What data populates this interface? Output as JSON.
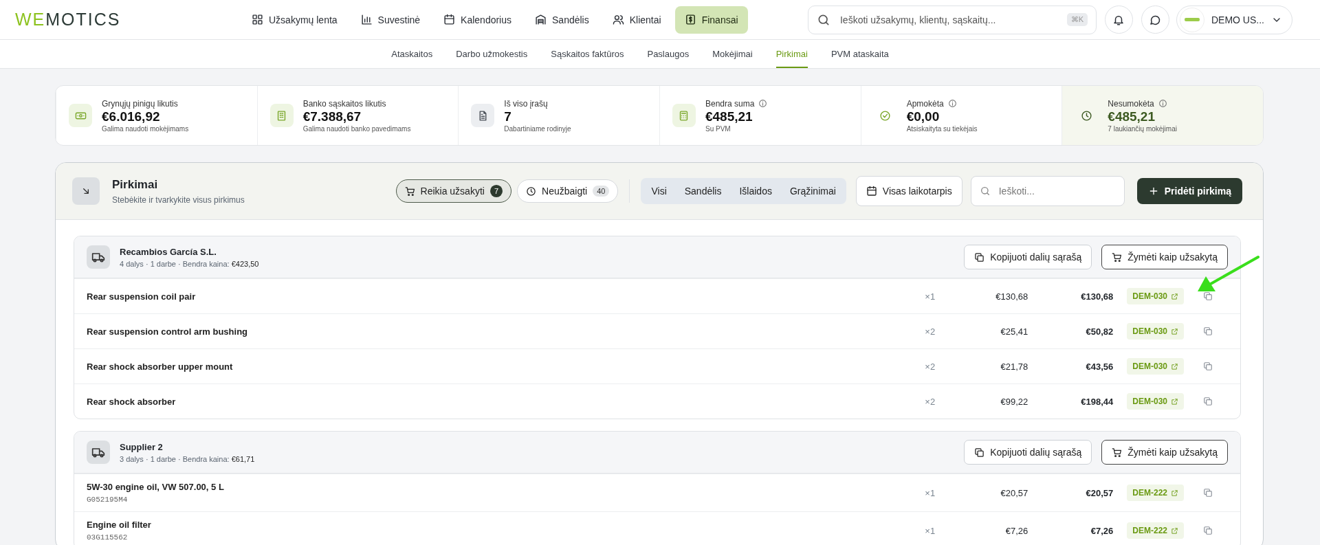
{
  "logo": {
    "accent": "WE",
    "rest": "MOTICS"
  },
  "nav": [
    {
      "label": "Užsakymų lenta",
      "kind": "grid",
      "selected": false
    },
    {
      "label": "Suvestinė",
      "kind": "chart",
      "selected": false
    },
    {
      "label": "Kalendorius",
      "kind": "calendar",
      "selected": false
    },
    {
      "label": "Sandėlis",
      "kind": "warehouse",
      "selected": false
    },
    {
      "label": "Klientai",
      "kind": "users",
      "selected": false
    },
    {
      "label": "Finansai",
      "kind": "dollar",
      "selected": true
    }
  ],
  "search": {
    "placeholder": "Ieškoti užsakymų, klientų, sąskaitų...",
    "shortcut": "⌘K"
  },
  "user": {
    "name": "DEMO US..."
  },
  "subnav": [
    {
      "label": "Ataskaitos",
      "selected": false
    },
    {
      "label": "Darbo užmokestis",
      "selected": false
    },
    {
      "label": "Sąskaitos faktūros",
      "selected": false
    },
    {
      "label": "Paslaugos",
      "selected": false
    },
    {
      "label": "Mokėjimai",
      "selected": false
    },
    {
      "label": "Pirkimai",
      "selected": true
    },
    {
      "label": "PVM ataskaita",
      "selected": false
    }
  ],
  "stats": [
    {
      "kind": "cash",
      "label": "Grynųjų pinigų likutis",
      "info": false,
      "value": "€6.016,92",
      "note": "Galima naudoti mokėjimams",
      "highlighted": false
    },
    {
      "kind": "bank",
      "label": "Banko sąskaitos likutis",
      "info": false,
      "value": "€7.388,67",
      "note": "Galima naudoti banko pavedimams",
      "highlighted": false
    },
    {
      "kind": "document",
      "label": "Iš viso įrašų",
      "info": false,
      "value": "7",
      "note": "Dabartiniame rodinyje",
      "highlighted": false
    },
    {
      "kind": "calculator",
      "label": "Bendra suma",
      "info": true,
      "value": "€485,21",
      "note": "Su PVM",
      "highlighted": false
    },
    {
      "kind": "check",
      "label": "Apmokėta",
      "info": true,
      "value": "€0,00",
      "note": "Atsiskaityta su tiekėjais",
      "highlighted": false
    },
    {
      "kind": "clock",
      "label": "Nesumokėta",
      "info": true,
      "value": "€485,21",
      "note": "7 laukiančių mokėjimai",
      "highlighted": true
    }
  ],
  "panel": {
    "title": "Pirkimai",
    "subtitle": "Stebėkite ir tvarkykite visus pirkimus",
    "filters": [
      {
        "kind": "cart",
        "label": "Reikia užsakyti",
        "count": "7",
        "selected": true
      },
      {
        "kind": "clock",
        "label": "Neužbaigti",
        "count": "40",
        "selected": false
      }
    ],
    "types": [
      "Visi",
      "Sandėlis",
      "Išlaidos",
      "Grąžinimai"
    ],
    "period": "Visas laikotarpis",
    "search_placeholder": "Ieškoti...",
    "add_button": "Pridėti pirkimą"
  },
  "groups": [
    {
      "name": "Recambios García S.L.",
      "summary": "4 dalys · 1 darbe · Bendra kaina: **€423,50**",
      "copy_button": "Kopijuoti dalių sąrašą",
      "mark_button": "Žymėti kaip užsakytą",
      "items": [
        {
          "name": "Rear suspension coil pair",
          "qty": "×1",
          "price": "€130,68",
          "total": "€130,68",
          "ref": "DEM-030"
        },
        {
          "name": "Rear suspension control arm bushing",
          "qty": "×2",
          "price": "€25,41",
          "total": "€50,82",
          "ref": "DEM-030"
        },
        {
          "name": "Rear shock absorber upper mount",
          "qty": "×2",
          "price": "€21,78",
          "total": "€43,56",
          "ref": "DEM-030"
        },
        {
          "name": "Rear shock absorber",
          "qty": "×2",
          "price": "€99,22",
          "total": "€198,44",
          "ref": "DEM-030"
        }
      ]
    },
    {
      "name": "Supplier 2",
      "summary": "3 dalys · 1 darbe · Bendra kaina: **€61,71**",
      "copy_button": "Kopijuoti dalių sąrašą",
      "mark_button": "Žymėti kaip užsakytą",
      "items": [
        {
          "name": "5W-30 engine oil, VW 507.00, 5 L",
          "code": "G052195M4",
          "qty": "×1",
          "price": "€20,57",
          "total": "€20,57",
          "ref": "DEM-222"
        },
        {
          "name": "Engine oil filter",
          "code": "03G115562",
          "qty": "×1",
          "price": "€7,26",
          "total": "€7,26",
          "ref": "DEM-222"
        }
      ]
    }
  ],
  "annotation": {
    "kind": "arrow"
  }
}
